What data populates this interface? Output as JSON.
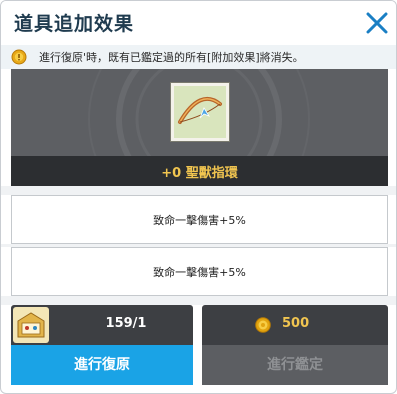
{
  "dialog": {
    "title": "道具追加效果",
    "close_icon": "close-icon"
  },
  "notice": {
    "icon": "coin-warning-icon",
    "text": "進行復原'時，既有已鑑定過的所有[附加效果]將消失。"
  },
  "item": {
    "icon": "bow-item-icon",
    "name": "+0 聖獸指環"
  },
  "options": [
    {
      "text": "致命一擊傷害+5%"
    },
    {
      "text": "致命一擊傷害+5%"
    }
  ],
  "restore": {
    "material_icon": "restore-material-icon",
    "count": "159/1",
    "button_label": "進行復原"
  },
  "appraise": {
    "cost_icon": "gold-coin-icon",
    "cost": "500",
    "button_label": "進行鑑定"
  },
  "colors": {
    "accent_blue": "#1aa3e6",
    "gold_text": "#f1c550",
    "disabled_gray": "#8f9194"
  }
}
